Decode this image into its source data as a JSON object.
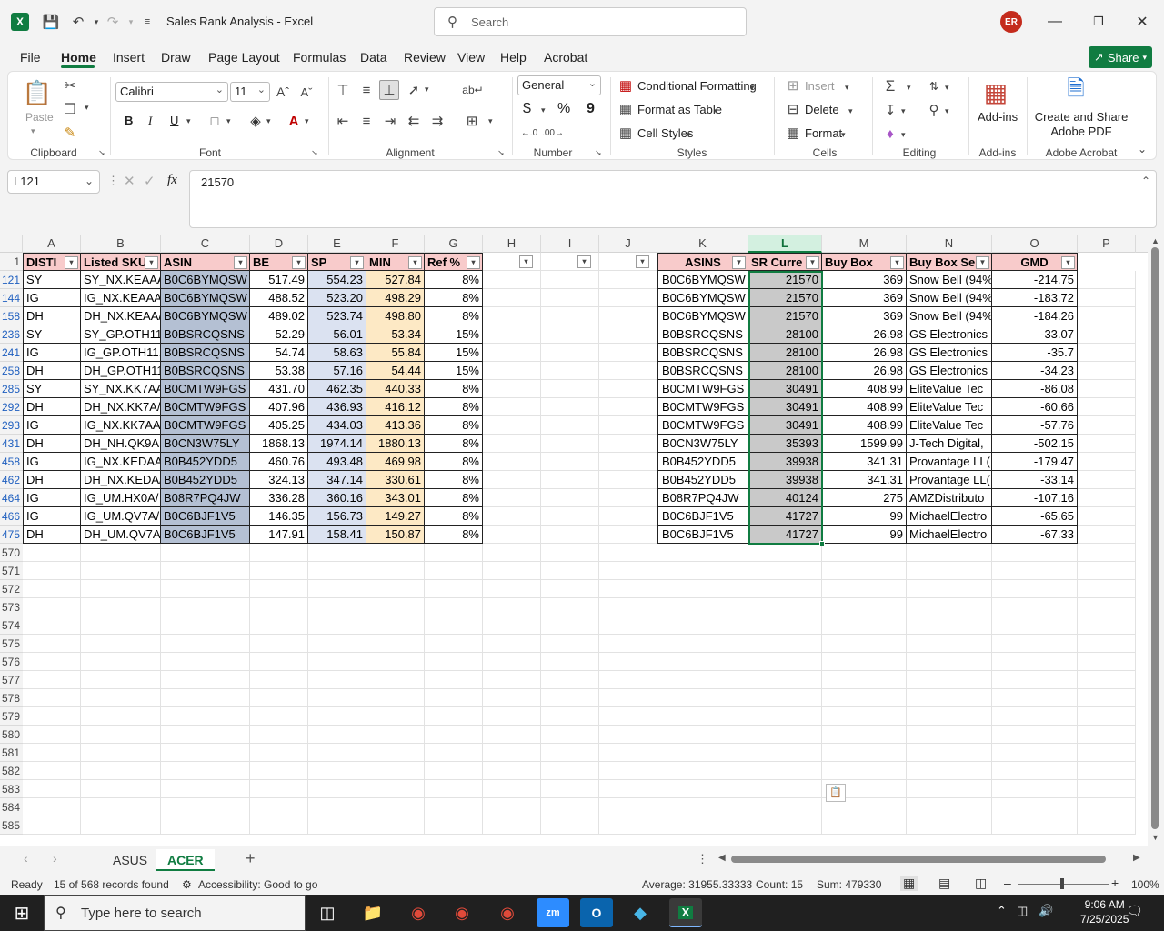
{
  "titlebar": {
    "title": "Sales Rank Analysis  -  Excel",
    "search_placeholder": "Search",
    "user_initials": "ER"
  },
  "menu": {
    "items": [
      "File",
      "Home",
      "Insert",
      "Draw",
      "Page Layout",
      "Formulas",
      "Data",
      "Review",
      "View",
      "Help",
      "Acrobat"
    ],
    "share_label": "Share"
  },
  "ribbon": {
    "clipboard": {
      "paste": "Paste",
      "label": "Clipboard"
    },
    "font": {
      "name": "Calibri",
      "size": "11",
      "label": "Font",
      "bold": "B",
      "italic": "I",
      "underline": "U"
    },
    "alignment": {
      "label": "Alignment"
    },
    "number": {
      "format": "General",
      "currency": "$",
      "percent": "%",
      "comma": "9",
      "label": "Number"
    },
    "styles": {
      "conditional": "Conditional Formatting",
      "table": "Format as Table",
      "cell_styles": "Cell Styles",
      "label": "Styles"
    },
    "cells": {
      "insert": "Insert",
      "delete": "Delete",
      "format": "Format",
      "label": "Cells"
    },
    "editing": {
      "label": "Editing"
    },
    "addins": {
      "button": "Add-ins",
      "label": "Add-ins"
    },
    "acrobat": {
      "button_line1": "Create and Share",
      "button_line2": "Adobe PDF",
      "label": "Adobe Acrobat"
    }
  },
  "formula_bar": {
    "name_box": "L121",
    "fx": "fx",
    "value": "21570"
  },
  "grid": {
    "columns": [
      "A",
      "B",
      "C",
      "D",
      "E",
      "F",
      "G",
      "H",
      "I",
      "J",
      "K",
      "L",
      "M",
      "N",
      "O",
      "P"
    ],
    "header_row_number": "1",
    "headers": {
      "A": "DISTI",
      "B": "Listed SKU",
      "C": "ASIN",
      "D": "BE",
      "E": "SP",
      "F": "MIN",
      "G": "Ref %",
      "K": "ASINS",
      "L": "SR Curre",
      "M": "Buy Box",
      "N": "Buy Box Sell",
      "O": "GMD"
    },
    "rows": [
      {
        "num": "121",
        "A": "SY",
        "B": "SY_NX.KEAAA",
        "C": "B0C6BYMQSW",
        "D": "517.49",
        "E": "554.23",
        "F": "527.84",
        "G": "8%",
        "K": "B0C6BYMQSW",
        "L": "21570",
        "M": "369",
        "N": "Snow Bell (94%",
        "O": "-214.75"
      },
      {
        "num": "144",
        "A": "IG",
        "B": "IG_NX.KEAAA",
        "C": "B0C6BYMQSW",
        "D": "488.52",
        "E": "523.20",
        "F": "498.29",
        "G": "8%",
        "K": "B0C6BYMQSW",
        "L": "21570",
        "M": "369",
        "N": "Snow Bell (94%",
        "O": "-183.72"
      },
      {
        "num": "158",
        "A": "DH",
        "B": "DH_NX.KEAA/",
        "C": "B0C6BYMQSW",
        "D": "489.02",
        "E": "523.74",
        "F": "498.80",
        "G": "8%",
        "K": "B0C6BYMQSW",
        "L": "21570",
        "M": "369",
        "N": "Snow Bell (94%",
        "O": "-184.26"
      },
      {
        "num": "236",
        "A": "SY",
        "B": "SY_GP.OTH11",
        "C": "B0BSRCQSNS",
        "D": "52.29",
        "E": "56.01",
        "F": "53.34",
        "G": "15%",
        "K": "B0BSRCQSNS",
        "L": "28100",
        "M": "26.98",
        "N": "GS Electronics",
        "O": "-33.07"
      },
      {
        "num": "241",
        "A": "IG",
        "B": "IG_GP.OTH11.",
        "C": "B0BSRCQSNS",
        "D": "54.74",
        "E": "58.63",
        "F": "55.84",
        "G": "15%",
        "K": "B0BSRCQSNS",
        "L": "28100",
        "M": "26.98",
        "N": "GS Electronics",
        "O": "-35.7"
      },
      {
        "num": "258",
        "A": "DH",
        "B": "DH_GP.OTH11",
        "C": "B0BSRCQSNS",
        "D": "53.38",
        "E": "57.16",
        "F": "54.44",
        "G": "15%",
        "K": "B0BSRCQSNS",
        "L": "28100",
        "M": "26.98",
        "N": "GS Electronics",
        "O": "-34.23"
      },
      {
        "num": "285",
        "A": "SY",
        "B": "SY_NX.KK7AA",
        "C": "B0CMTW9FGS",
        "D": "431.70",
        "E": "462.35",
        "F": "440.33",
        "G": "8%",
        "K": "B0CMTW9FGS",
        "L": "30491",
        "M": "408.99",
        "N": "EliteValue Tec",
        "O": "-86.08"
      },
      {
        "num": "292",
        "A": "DH",
        "B": "DH_NX.KK7A/",
        "C": "B0CMTW9FGS",
        "D": "407.96",
        "E": "436.93",
        "F": "416.12",
        "G": "8%",
        "K": "B0CMTW9FGS",
        "L": "30491",
        "M": "408.99",
        "N": "EliteValue Tec",
        "O": "-60.66"
      },
      {
        "num": "293",
        "A": "IG",
        "B": "IG_NX.KK7AA",
        "C": "B0CMTW9FGS",
        "D": "405.25",
        "E": "434.03",
        "F": "413.36",
        "G": "8%",
        "K": "B0CMTW9FGS",
        "L": "30491",
        "M": "408.99",
        "N": "EliteValue Tec",
        "O": "-57.76"
      },
      {
        "num": "431",
        "A": "DH",
        "B": "DH_NH.QK9A.",
        "C": "B0CN3W75LY",
        "D": "1868.13",
        "E": "1974.14",
        "F": "1880.13",
        "G": "8%",
        "K": "B0CN3W75LY",
        "L": "35393",
        "M": "1599.99",
        "N": "J-Tech Digital,",
        "O": "-502.15"
      },
      {
        "num": "458",
        "A": "IG",
        "B": "IG_NX.KEDAA",
        "C": "B0B452YDD5",
        "D": "460.76",
        "E": "493.48",
        "F": "469.98",
        "G": "8%",
        "K": "B0B452YDD5",
        "L": "39938",
        "M": "341.31",
        "N": "Provantage LL(",
        "O": "-179.47"
      },
      {
        "num": "462",
        "A": "DH",
        "B": "DH_NX.KEDA/",
        "C": "B0B452YDD5",
        "D": "324.13",
        "E": "347.14",
        "F": "330.61",
        "G": "8%",
        "K": "B0B452YDD5",
        "L": "39938",
        "M": "341.31",
        "N": "Provantage LL(",
        "O": "-33.14"
      },
      {
        "num": "464",
        "A": "IG",
        "B": "IG_UM.HX0A/",
        "C": "B08R7PQ4JW",
        "D": "336.28",
        "E": "360.16",
        "F": "343.01",
        "G": "8%",
        "K": "B08R7PQ4JW",
        "L": "40124",
        "M": "275",
        "N": "AMZDistributo",
        "O": "-107.16"
      },
      {
        "num": "466",
        "A": "IG",
        "B": "IG_UM.QV7A/",
        "C": "B0C6BJF1V5",
        "D": "146.35",
        "E": "156.73",
        "F": "149.27",
        "G": "8%",
        "K": "B0C6BJF1V5",
        "L": "41727",
        "M": "99",
        "N": "MichaelElectro",
        "O": "-65.65"
      },
      {
        "num": "475",
        "A": "DH",
        "B": "DH_UM.QV7A",
        "C": "B0C6BJF1V5",
        "D": "147.91",
        "E": "158.41",
        "F": "150.87",
        "G": "8%",
        "K": "B0C6BJF1V5",
        "L": "41727",
        "M": "99",
        "N": "MichaelElectro",
        "O": "-67.33"
      }
    ],
    "empty_rows": [
      "570",
      "571",
      "572",
      "573",
      "574",
      "575",
      "576",
      "577",
      "578",
      "579",
      "580",
      "581",
      "582",
      "583",
      "584",
      "585"
    ],
    "colors": {
      "header_pink": "#f8cbcb",
      "asin_fill": "#b4c0d3",
      "sp_fill": "#dbe2f1",
      "min_fill": "#fde9c5",
      "sr_fill": "#c9c9c9",
      "accent": "#107c41"
    }
  },
  "sheets": {
    "tabs": [
      "ASUS",
      "ACER"
    ],
    "active": "ACER",
    "add": "+"
  },
  "status": {
    "ready": "Ready",
    "records": "15 of 568 records found",
    "accessibility": "Accessibility: Good to go",
    "average": "Average: 31955.33333",
    "count": "Count: 15",
    "sum": "Sum: 479330",
    "zoom": "100%"
  },
  "taskbar": {
    "search_placeholder": "Type here to search",
    "time": "9:06 AM",
    "date": "7/25/2025"
  }
}
